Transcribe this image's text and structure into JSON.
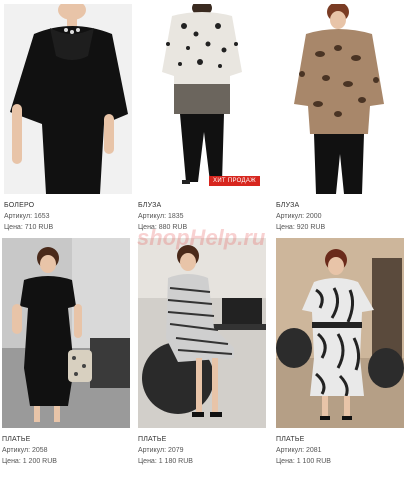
{
  "watermark": "shopHelp.ru",
  "products": [
    {
      "name": "БОЛЕРО",
      "article": "Артикул: 1653",
      "price": "Цена: 710 RUB"
    },
    {
      "name": "БЛУЗА",
      "article": "Артикул: 1835",
      "price": "Цена: 880 RUB",
      "badge": "ХИТ ПРОДАЖ"
    },
    {
      "name": "БЛУЗА",
      "article": "Артикул: 2000",
      "price": "Цена: 920 RUB"
    },
    {
      "name": "ПЛАТЬЕ",
      "article": "Артикул: 2058",
      "price": "Цена: 1 200 RUB"
    },
    {
      "name": "ПЛАТЬЕ",
      "article": "Артикул: 2079",
      "price": "Цена: 1 180 RUB"
    },
    {
      "name": "ПЛАТЬЕ",
      "article": "Артикул: 2081",
      "price": "Цена: 1 100 RUB"
    }
  ],
  "colors": {
    "badge": "#d7261e",
    "text": "#333333"
  }
}
